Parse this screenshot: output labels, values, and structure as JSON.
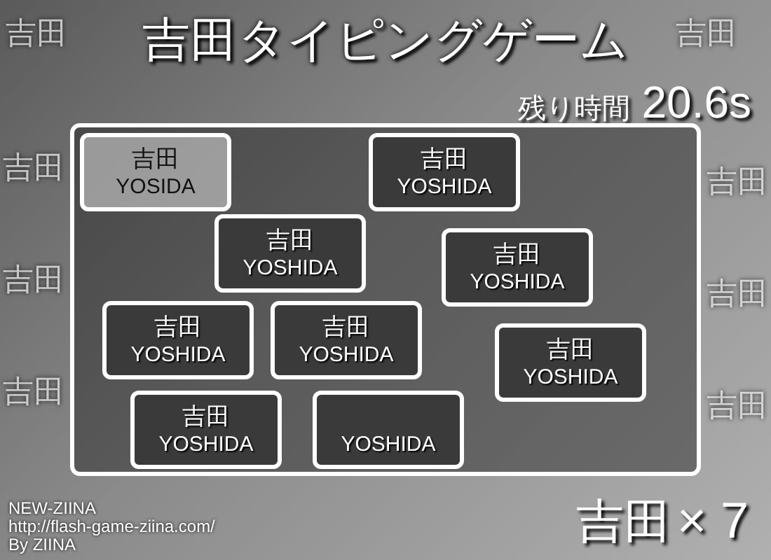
{
  "title": "吉田タイピングゲーム",
  "timer": {
    "label": "残り時間",
    "value": "20.6s"
  },
  "background_marks": [
    "吉田",
    "吉田",
    "吉田",
    "吉田",
    "吉田",
    "吉田",
    "吉田",
    "吉田"
  ],
  "cards": [
    {
      "name": "吉田",
      "reading": "YOSIDA",
      "active": true
    },
    {
      "name": "吉田",
      "reading": "YOSHIDA",
      "active": false
    },
    {
      "name": "吉田",
      "reading": "YOSHIDA",
      "active": false
    },
    {
      "name": "吉田",
      "reading": "YOSHIDA",
      "active": false
    },
    {
      "name": "吉田",
      "reading": "YOSHIDA",
      "active": false
    },
    {
      "name": "吉田",
      "reading": "YOSHIDA",
      "active": false
    },
    {
      "name": "吉田",
      "reading": "YOSHIDA",
      "active": false
    },
    {
      "name": "吉田",
      "reading": "YOSHIDA",
      "active": false
    },
    {
      "reading": "YOSHIDA",
      "active": false
    }
  ],
  "score": {
    "name": "吉田",
    "count": "× 7"
  },
  "credits": [
    "NEW-ZIINA",
    "http://flash-game-ziina.com/",
    "By ZIINA"
  ]
}
